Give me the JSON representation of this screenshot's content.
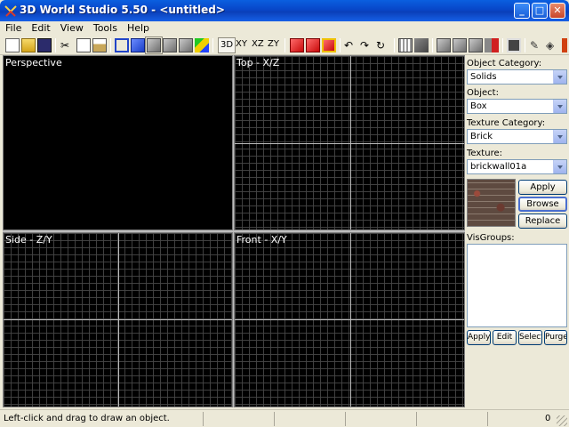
{
  "window": {
    "title": "3D World Studio 5.50 - <untitled>"
  },
  "menu": [
    "File",
    "Edit",
    "View",
    "Tools",
    "Help"
  ],
  "toolbar": {
    "view_3d": "3D",
    "view_xy": "XY",
    "view_xz": "XZ",
    "view_zy": "ZY",
    "icons": [
      "new-file-icon",
      "open-folder-icon",
      "save-icon",
      "cut-icon",
      "copy-icon",
      "paste-icon",
      "wireframe-cube-icon",
      "solid-cube-icon",
      "textured-cube-icon",
      "gray-cube-icon",
      "shaded-cube-icon",
      "color-cubes-icon",
      "red-cube-icon",
      "red-cube-select-icon",
      "red-cube-outline-icon",
      "rotate-x-icon",
      "rotate-y-icon",
      "rotate-z-icon",
      "grid-snap-icon",
      "group-icon",
      "gray-cube-1-icon",
      "gray-cube-2-icon",
      "gray-cube-3-icon",
      "red-gray-cube-icon",
      "movie-icon",
      "pencil-icon",
      "paint-bucket-icon"
    ]
  },
  "viewports": {
    "perspective": "Perspective",
    "top": "Top - X/Z",
    "side": "Side - Z/Y",
    "front": "Front - X/Y"
  },
  "panel": {
    "object_category_label": "Object Category:",
    "object_category_value": "Solids",
    "object_label": "Object:",
    "object_value": "Box",
    "texture_category_label": "Texture Category:",
    "texture_category_value": "Brick",
    "texture_label": "Texture:",
    "texture_value": "brickwall01a",
    "apply_label": "Apply",
    "browse_label": "Browse",
    "replace_label": "Replace",
    "visgroups_label": "VisGroups:",
    "vis_apply_label": "Apply",
    "vis_edit_label": "Edit",
    "vis_select_label": "Select",
    "vis_purge_label": "Purge"
  },
  "status": {
    "message": "Left-click and drag to draw an object.",
    "count": "0"
  },
  "colors": {
    "title_bar": "#0a4fd8",
    "viewport_bg": "#000000",
    "grid_line": "#464646",
    "axis_line": "#bdbdbd"
  }
}
